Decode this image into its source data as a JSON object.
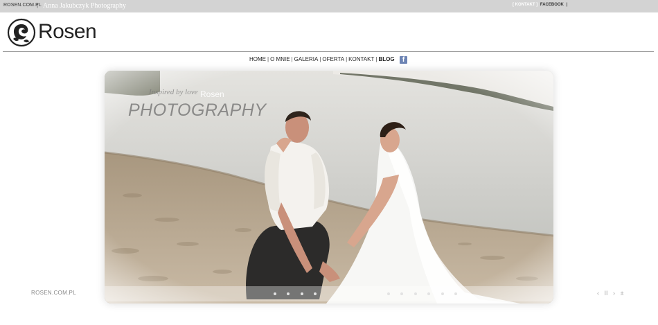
{
  "topbar": {
    "site": "ROSEN.COM.PL",
    "separator": "|",
    "tagline": "Anna Jakubczyk Photography",
    "kontakt": "[ KONTAKT ]",
    "facebook": "FACEBOOK",
    "end_sep": "|"
  },
  "logo": {
    "text": "Rosen"
  },
  "nav": {
    "items": [
      "HOME",
      "O MNIE",
      "GALERIA",
      "OFERTA",
      "KONTAKT",
      "BLOG"
    ],
    "separator": "|",
    "active": "BLOG"
  },
  "slider": {
    "watermark_small": "Inspired by love",
    "watermark_brand": "Rosen",
    "watermark_big": "PHOTOGRAPHY",
    "dot_count": 7,
    "colors": {
      "sand": "#b9a994",
      "water": "#c9cac6",
      "sky": "#e6e6e4"
    }
  },
  "footer": {
    "site": "ROSEN.COM.PL",
    "controls": {
      "prev": "‹",
      "pause": "II",
      "next": "›",
      "fullscreen": "±"
    }
  }
}
